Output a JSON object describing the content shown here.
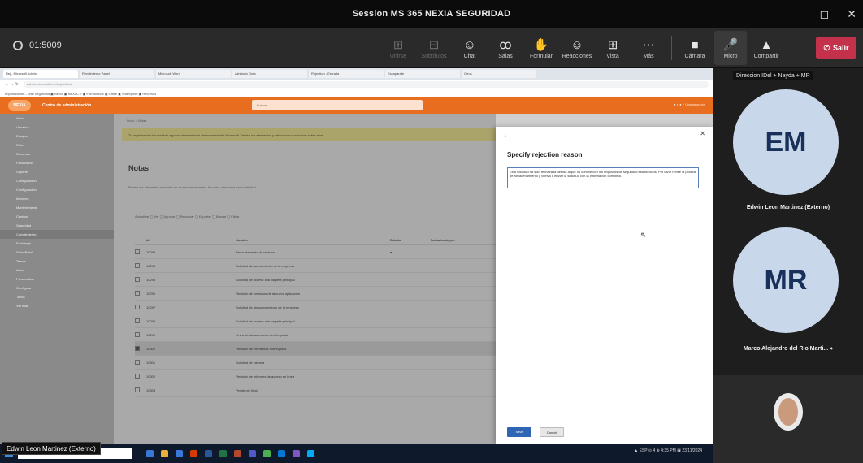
{
  "window": {
    "title": "Session MS 365 NEXIA SEGURIDAD",
    "controls": {
      "minimize": "—",
      "maximize": "◻",
      "close": "✕"
    }
  },
  "meeting": {
    "timer": "01:5009",
    "tools": [
      {
        "label": "Unirse",
        "icon": "join-icon",
        "glyph": "⊞",
        "dim": true
      },
      {
        "label": "Subtítulos",
        "icon": "captions-icon",
        "glyph": "⊟",
        "dim": true
      },
      {
        "label": "Chat",
        "icon": "chat-icon",
        "glyph": "☺",
        "dim": false
      },
      {
        "label": "Salas",
        "icon": "rooms-icon",
        "glyph": "ꝏ",
        "dim": false
      },
      {
        "label": "Formular",
        "icon": "raise-hand-icon",
        "glyph": "✋",
        "dim": false
      },
      {
        "label": "Reacciones",
        "icon": "reactions-icon",
        "glyph": "☺",
        "dim": false
      },
      {
        "label": "Vista",
        "icon": "view-icon",
        "glyph": "⊞",
        "dim": false
      },
      {
        "label": "Más",
        "icon": "more-icon",
        "glyph": "⋯",
        "dim": false
      }
    ],
    "media": [
      {
        "label": "Cámara",
        "icon": "camera-icon",
        "glyph": "■"
      },
      {
        "label": "Micro",
        "icon": "mic-icon",
        "glyph": "🎤"
      },
      {
        "label": "Compartir",
        "icon": "share-icon",
        "glyph": "▲"
      }
    ],
    "leave": {
      "label": "Salir",
      "icon": "phone-hangup-icon",
      "glyph": "✆"
    }
  },
  "browser": {
    "tabs": [
      "Rej - Microsoft Admin",
      "Rendimiento Panel",
      "Microsoft Word",
      "Aleatorio Guía",
      "Rejection - Entrada",
      "Escaparate",
      "Otros"
    ],
    "url": "admin.microsoft.com/rejections",
    "bookmarks": "Importado de...  Wiki Seguridad  ▣ NEXA  ▣ NEXIA-TI  ▣ Formularios  ▣ Office  ▣ Sharepoint  ▣ Recursos"
  },
  "app": {
    "logo": "NEXIA",
    "name": "Centro de administración",
    "search_placeholder": "Buscar",
    "header_links": "● ◐ ● ?  Cuenta admin"
  },
  "sidenav": {
    "items": [
      "Inicio",
      "Usuarios",
      "Equipos",
      "Roles",
      "Recursos",
      "Facturación",
      "Soporte",
      "Configuración",
      "Configuración",
      "Informes",
      "Mantenimiento",
      "Centros",
      "Seguridad",
      "Cumplimiento",
      "Exchange",
      "SharePoint",
      "Teams",
      "Azure",
      "Personalizar",
      "Configurar",
      "Todos",
      "Ver más"
    ]
  },
  "content": {
    "breadcrumb": "Inicio > Notas",
    "warning": "Tu organización ha enviado algunos elementos al almacenamiento Microsoft. Revisa los elementos y selecciona una acción sobre ellos.",
    "title": "Notas",
    "subtitle": "Revisa los elementos enviados en el almacenamiento. Aprueba o rechaza cada solicitud.",
    "commands": "Actualizar  ▢ Ver  ▢ Aprobar  ▢ Rechazar  ▢ Exportar  ▢ Buscar  ▢ Filtrar",
    "columns": [
      "",
      "Id",
      "Nombre",
      "Estado",
      "Actualizado por"
    ],
    "rows": [
      {
        "id": "10293",
        "name": "Tarea elemento de revisión",
        "status": "●",
        "by": "",
        "checked": false,
        "selected": false
      },
      {
        "id": "10294",
        "name": "Solicitud almacenamiento de la empresa",
        "status": "",
        "by": "",
        "checked": false,
        "selected": false
      },
      {
        "id": "10295",
        "name": "Solicitud de acceso a la carpeta principal",
        "status": "",
        "by": "",
        "checked": false,
        "selected": false
      },
      {
        "id": "10296",
        "name": "Revisión de permisos de la nueva aplicación",
        "status": "",
        "by": "",
        "checked": false,
        "selected": false
      },
      {
        "id": "10297",
        "name": "Solicitud de almacenamiento de la empresa",
        "status": "",
        "by": "",
        "checked": false,
        "selected": false
      },
      {
        "id": "10298",
        "name": "Solicitud de acceso a la carpeta principal",
        "status": "",
        "by": "",
        "checked": false,
        "selected": false
      },
      {
        "id": "10299",
        "name": "Línea de almacenamiento integrada",
        "status": "",
        "by": "",
        "checked": false,
        "selected": false
      },
      {
        "id": "10300",
        "name": "Revisión de elementos restringidos",
        "status": "",
        "by": "",
        "checked": true,
        "selected": true
      },
      {
        "id": "10301",
        "name": "Solicitud de carpeta",
        "status": "",
        "by": "",
        "checked": false,
        "selected": false
      },
      {
        "id": "10302",
        "name": "Revisión de informes de acceso en línea",
        "status": "",
        "by": "",
        "checked": false,
        "selected": false
      },
      {
        "id": "10303",
        "name": "Pendiente final",
        "status": "",
        "by": "",
        "checked": false,
        "selected": false
      }
    ]
  },
  "panel": {
    "back_glyph": "←",
    "close_glyph": "✕",
    "title": "Specify rejection reason",
    "reason": "Esta solicitud ha sido rechazada debido a que no cumple con los requisitos de seguridad establecidos. Por favor revise la política de almacenamiento y vuelva a enviar la solicitud con la información completa.",
    "save_label": "Save",
    "cancel_label": "Cancel"
  },
  "taskbar": {
    "tray_text": "▲  ESP  ⊙ 4 ⊕ 4:35 PM  ▣ 23/11/2024"
  },
  "presenter": {
    "name": "Edwin Leon Martinez (Externo)"
  },
  "participants": {
    "top_label": "Direccion IDel + Nayda + MR",
    "list": [
      {
        "initials": "EM",
        "name": "Edwin Leon Martinez (Externo)"
      },
      {
        "initials": "MR",
        "name": "Marco Alejandro del Rio Marti..."
      }
    ],
    "pin_glyph": "⌖"
  },
  "colors": {
    "leave": "#c4314b",
    "app_header": "#e86d1f",
    "avatar_bg": "#c9d7ea",
    "primary_button": "#2f66b3"
  }
}
